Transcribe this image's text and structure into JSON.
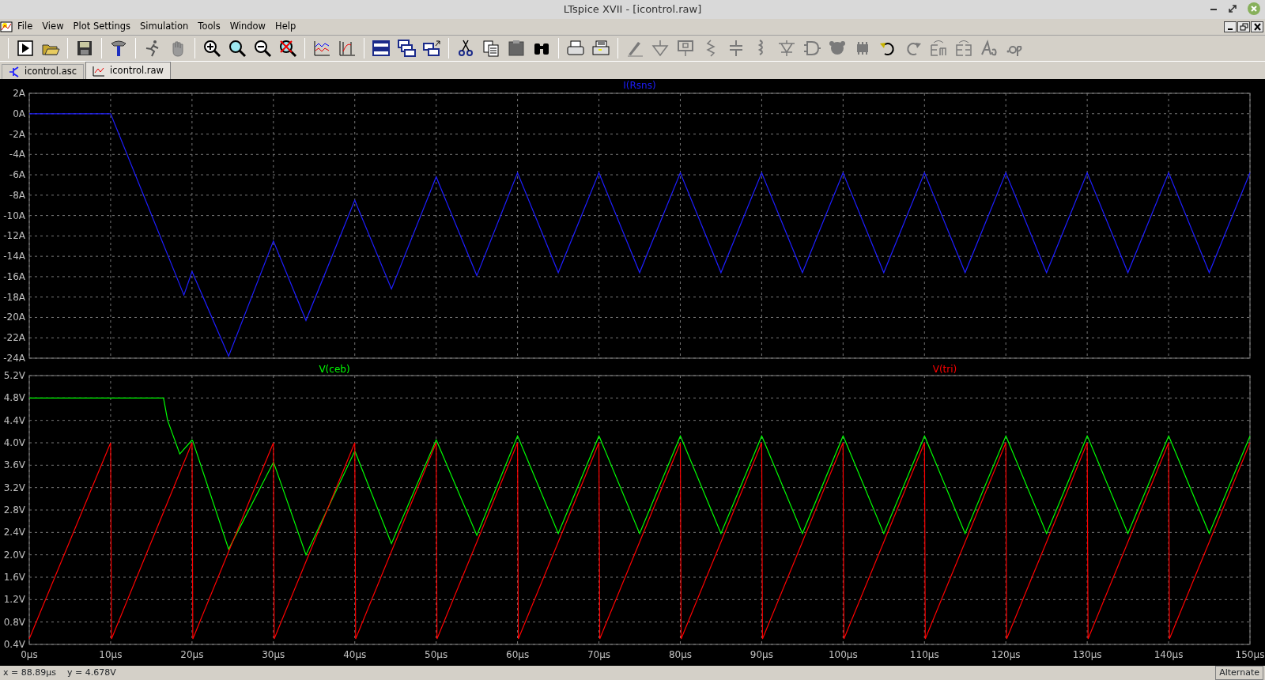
{
  "window": {
    "title": "LTspice XVII - [icontrol.raw]"
  },
  "menu": [
    "File",
    "View",
    "Plot Settings",
    "Simulation",
    "Tools",
    "Window",
    "Help"
  ],
  "tabs": [
    {
      "label": "icontrol.asc",
      "kind": "schematic",
      "selected": false
    },
    {
      "label": "icontrol.raw",
      "kind": "waveform",
      "selected": true
    }
  ],
  "plots": [
    {
      "chart_data": {
        "type": "line",
        "grid": true,
        "x": [
          0,
          10,
          19,
          20,
          24.5,
          30,
          34,
          40,
          44.5,
          50,
          55,
          60,
          65,
          70,
          75,
          80,
          85,
          90,
          95,
          100,
          105,
          110,
          115,
          120,
          125,
          130,
          135,
          140,
          145,
          150
        ],
        "series": [
          {
            "name": "I(Rsns)",
            "color": "#1e1eff",
            "values": [
              0,
              0,
              -17.8,
              -15.5,
              -23.8,
              -12.5,
              -20.3,
              -8.5,
              -17.2,
              -6.2,
              -15.9,
              -5.8,
              -15.6,
              -5.8,
              -15.6,
              -5.8,
              -15.6,
              -5.8,
              -15.6,
              -5.8,
              -15.6,
              -5.8,
              -15.6,
              -5.8,
              -15.6,
              -5.8,
              -15.6,
              -5.8,
              -15.6,
              -5.8
            ]
          }
        ],
        "xlim": [
          0,
          150
        ],
        "ylim": [
          -24,
          2
        ],
        "yticks": [
          {
            "value": 2,
            "label": "2A"
          },
          {
            "value": 0,
            "label": "0A"
          },
          {
            "value": -2,
            "label": "-2A"
          },
          {
            "value": -4,
            "label": "-4A"
          },
          {
            "value": -6,
            "label": "-6A"
          },
          {
            "value": -8,
            "label": "-8A"
          },
          {
            "value": -10,
            "label": "-10A"
          },
          {
            "value": -12,
            "label": "-12A"
          },
          {
            "value": -14,
            "label": "-14A"
          },
          {
            "value": -16,
            "label": "-16A"
          },
          {
            "value": -18,
            "label": "-18A"
          },
          {
            "value": -20,
            "label": "-20A"
          },
          {
            "value": -22,
            "label": "-22A"
          },
          {
            "value": -24,
            "label": "-24A"
          }
        ]
      }
    },
    {
      "chart_data": {
        "type": "line",
        "grid": true,
        "x": [
          0,
          10,
          10.1,
          16.5,
          17,
          18.5,
          20,
          20.1,
          24.5,
          30,
          30.1,
          34,
          40,
          40.1,
          44.5,
          50,
          50.1,
          55,
          60,
          60.1,
          65,
          70,
          70.1,
          75,
          80,
          80.1,
          85,
          90,
          90.1,
          95,
          100,
          100.1,
          105,
          110,
          110.1,
          115,
          120,
          120.1,
          125,
          130,
          130.1,
          135,
          140,
          140.1,
          145,
          150
        ],
        "series": [
          {
            "name": "V(ceb)",
            "color": "#00ff00",
            "values": [
              4.8,
              4.8,
              4.8,
              4.8,
              4.4,
              3.8,
              4.05,
              4.03,
              2.1,
              3.65,
              3.62,
              2.0,
              3.85,
              3.82,
              2.2,
              4.05,
              4.02,
              2.35,
              4.12,
              4.09,
              2.38,
              4.12,
              4.09,
              2.38,
              4.12,
              4.09,
              2.38,
              4.12,
              4.09,
              2.38,
              4.12,
              4.09,
              2.38,
              4.12,
              4.09,
              2.38,
              4.12,
              4.09,
              2.38,
              4.12,
              4.09,
              2.38,
              4.12,
              4.09,
              2.38,
              4.12
            ]
          },
          {
            "name": "V(tri)",
            "color": "#ff0000",
            "values": [
              0.5,
              4.0,
              0.5,
              2.76,
              2.94,
              3.47,
              4.0,
              0.5,
              2.06,
              4.0,
              0.5,
              1.88,
              4.0,
              0.5,
              2.06,
              4.0,
              0.5,
              2.23,
              4.0,
              0.5,
              2.23,
              4.0,
              0.5,
              2.23,
              4.0,
              0.5,
              2.23,
              4.0,
              0.5,
              2.23,
              4.0,
              0.5,
              2.23,
              4.0,
              0.5,
              2.23,
              4.0,
              0.5,
              2.23,
              4.0,
              0.5,
              2.23,
              4.0,
              0.5,
              2.23,
              4.0
            ]
          }
        ],
        "xlim": [
          0,
          150
        ],
        "ylim": [
          0.4,
          5.2
        ],
        "xticks": [
          {
            "value": 0,
            "label": "0µs"
          },
          {
            "value": 10,
            "label": "10µs"
          },
          {
            "value": 20,
            "label": "20µs"
          },
          {
            "value": 30,
            "label": "30µs"
          },
          {
            "value": 40,
            "label": "40µs"
          },
          {
            "value": 50,
            "label": "50µs"
          },
          {
            "value": 60,
            "label": "60µs"
          },
          {
            "value": 70,
            "label": "70µs"
          },
          {
            "value": 80,
            "label": "80µs"
          },
          {
            "value": 90,
            "label": "90µs"
          },
          {
            "value": 100,
            "label": "100µs"
          },
          {
            "value": 110,
            "label": "110µs"
          },
          {
            "value": 120,
            "label": "120µs"
          },
          {
            "value": 130,
            "label": "130µs"
          },
          {
            "value": 140,
            "label": "140µs"
          },
          {
            "value": 150,
            "label": "150µs"
          }
        ],
        "yticks": [
          {
            "value": 5.2,
            "label": "5.2V"
          },
          {
            "value": 4.8,
            "label": "4.8V"
          },
          {
            "value": 4.4,
            "label": "4.4V"
          },
          {
            "value": 4.0,
            "label": "4.0V"
          },
          {
            "value": 3.6,
            "label": "3.6V"
          },
          {
            "value": 3.2,
            "label": "3.2V"
          },
          {
            "value": 2.8,
            "label": "2.8V"
          },
          {
            "value": 2.4,
            "label": "2.4V"
          },
          {
            "value": 2.0,
            "label": "2.0V"
          },
          {
            "value": 1.6,
            "label": "1.6V"
          },
          {
            "value": 1.2,
            "label": "1.2V"
          },
          {
            "value": 0.8,
            "label": "0.8V"
          },
          {
            "value": 0.4,
            "label": "0.4V"
          }
        ]
      }
    }
  ],
  "status_bar": {
    "cursor_x": "x = 88.89µs",
    "cursor_y": "y = 4.678V",
    "mode": "Alternate"
  }
}
